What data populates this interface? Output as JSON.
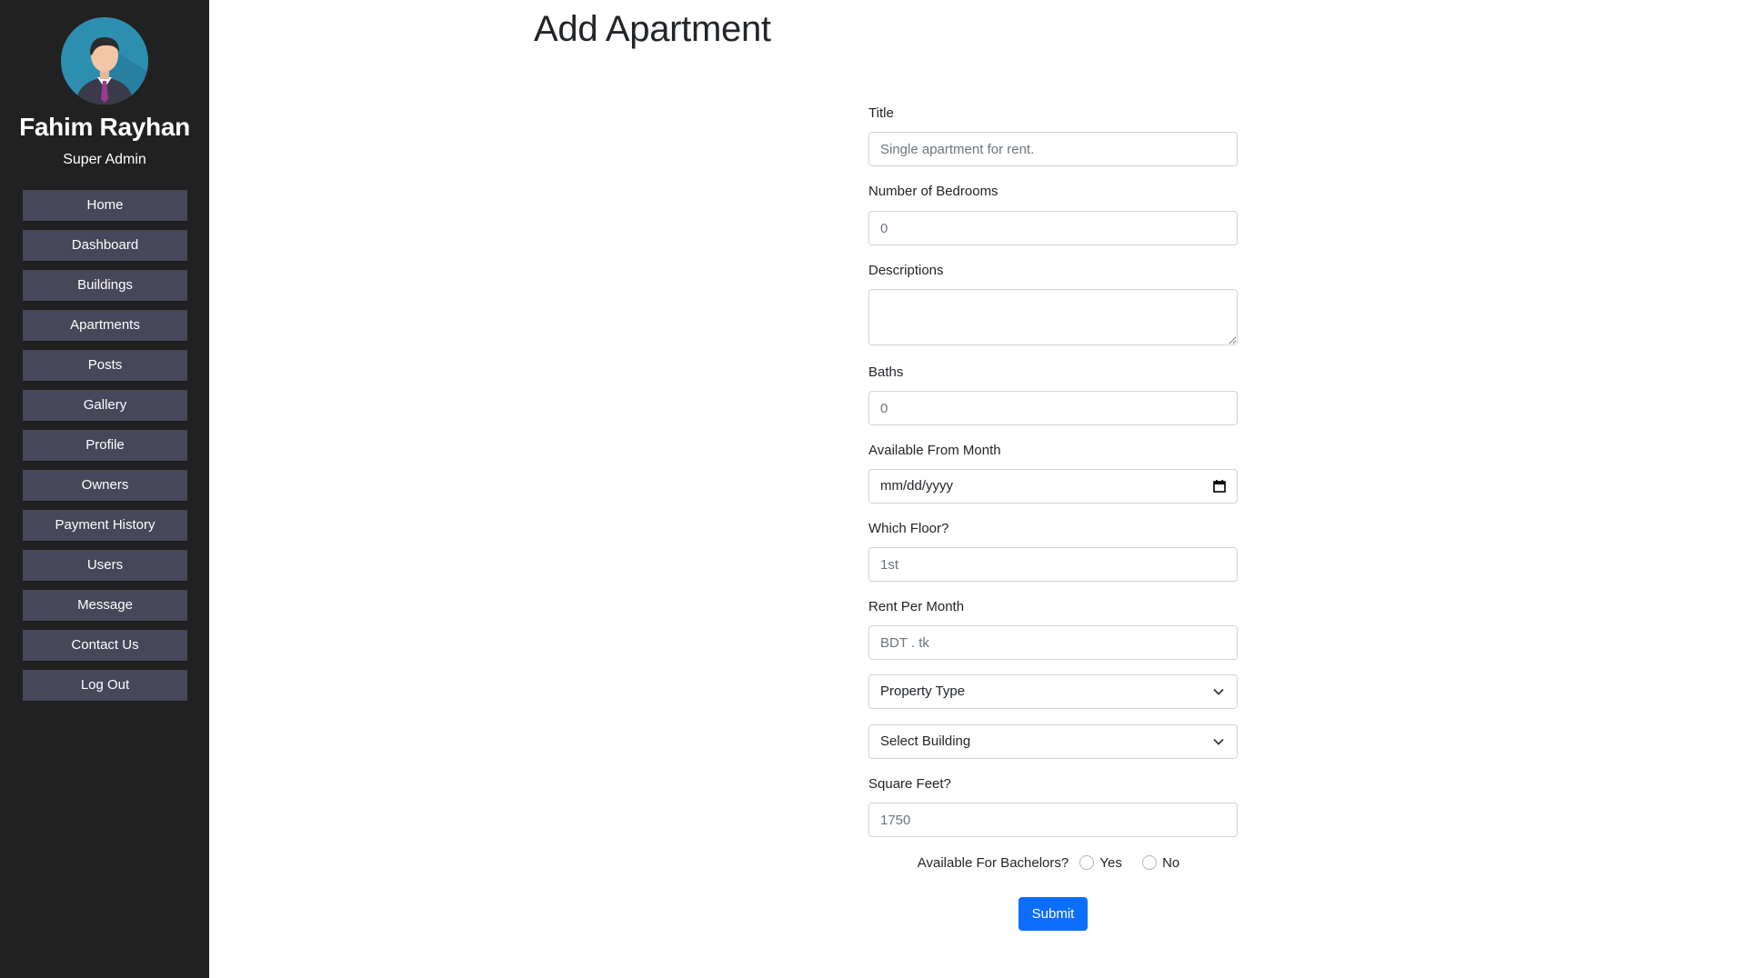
{
  "sidebar": {
    "user_name": "Fahim Rayhan",
    "user_role": "Super Admin",
    "bg_color": "#212121",
    "item_color": "#47475a",
    "items": [
      {
        "label": "Home"
      },
      {
        "label": "Dashboard"
      },
      {
        "label": "Buildings"
      },
      {
        "label": "Apartments"
      },
      {
        "label": "Posts"
      },
      {
        "label": "Gallery"
      },
      {
        "label": "Profile"
      },
      {
        "label": "Owners"
      },
      {
        "label": "Payment History"
      },
      {
        "label": "Users"
      },
      {
        "label": "Message"
      },
      {
        "label": "Contact Us"
      },
      {
        "label": "Log Out"
      }
    ]
  },
  "page": {
    "title": "Add Apartment"
  },
  "form": {
    "title": {
      "label": "Title",
      "placeholder": "Single apartment for rent."
    },
    "bedrooms": {
      "label": "Number of Bedrooms",
      "placeholder": "0"
    },
    "descriptions": {
      "label": "Descriptions",
      "placeholder": ""
    },
    "baths": {
      "label": "Baths",
      "placeholder": "0"
    },
    "available_from": {
      "label": "Available From Month",
      "value": "mm/dd/yyyy"
    },
    "floor": {
      "label": "Which Floor?",
      "placeholder": "1st"
    },
    "rent": {
      "label": "Rent Per Month",
      "placeholder": "BDT . tk"
    },
    "property_type": {
      "selected": "Property Type"
    },
    "building": {
      "selected": "Select Building"
    },
    "square_feet": {
      "label": "Square Feet?",
      "placeholder": "1750"
    },
    "bachelors": {
      "label": "Available For Bachelors?",
      "options": [
        "Yes",
        "No"
      ]
    },
    "submit_label": "Submit",
    "accent_color": "#0d6efd"
  }
}
